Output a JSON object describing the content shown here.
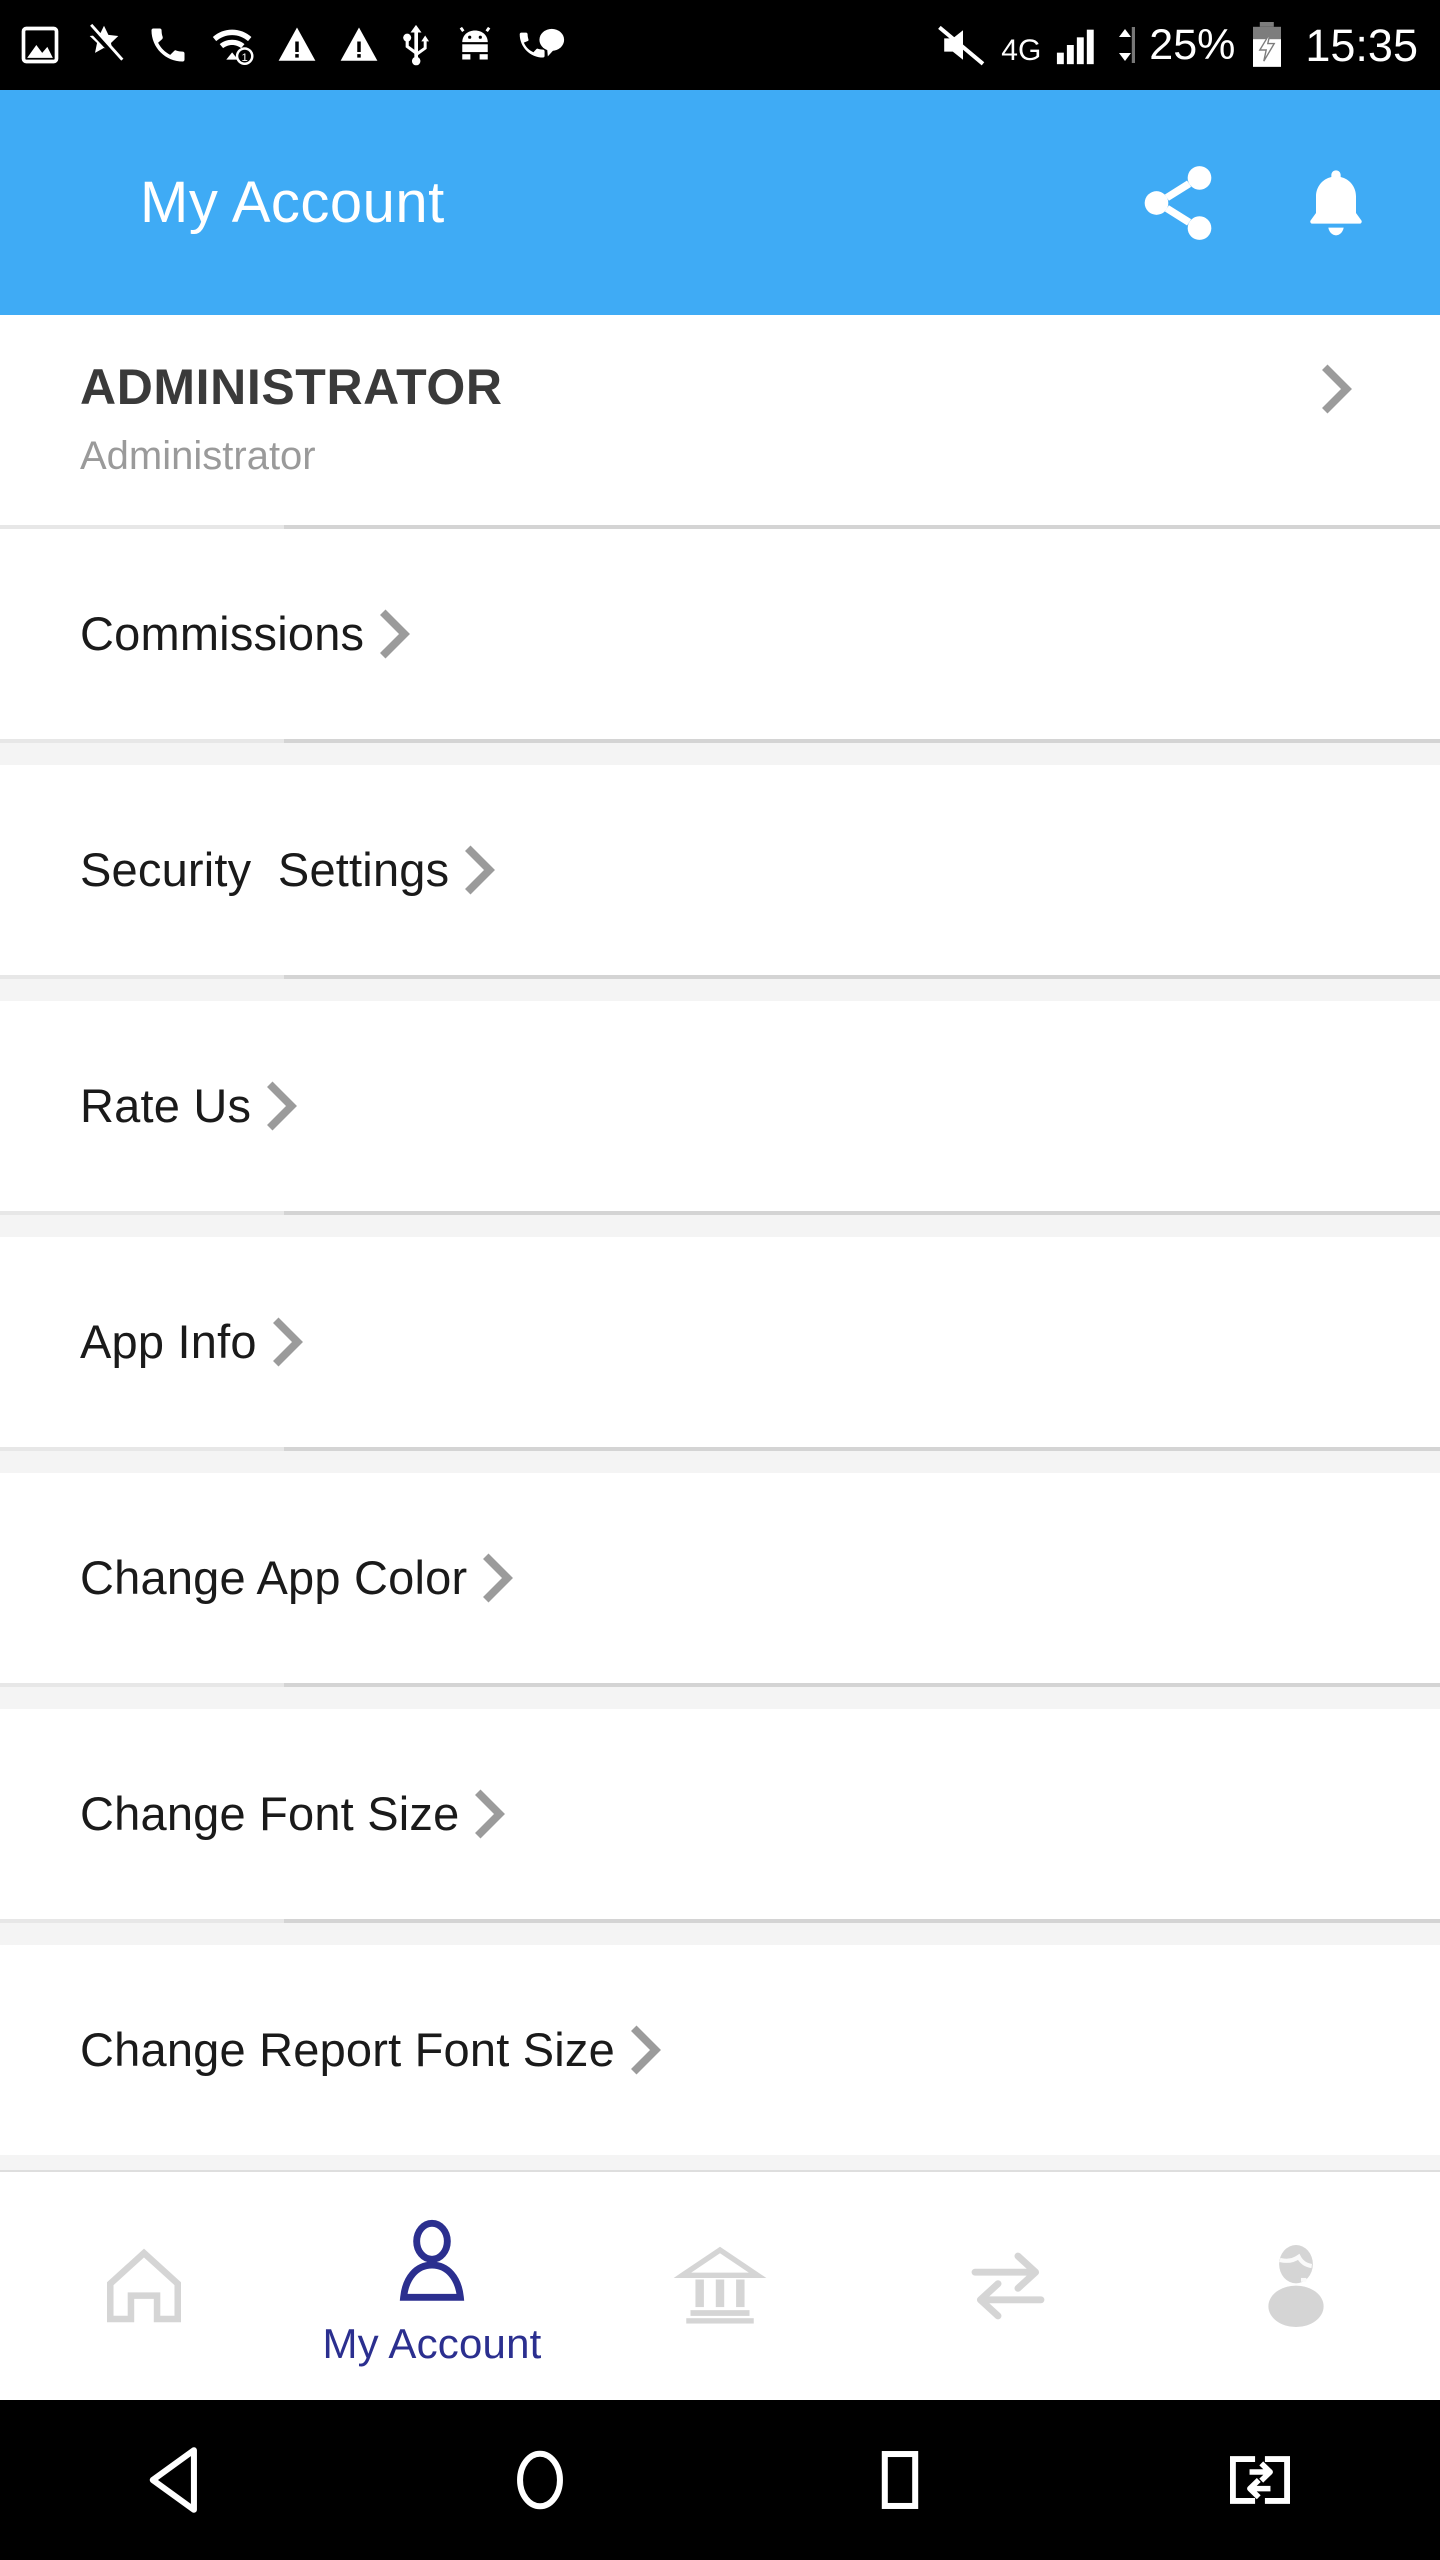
{
  "status_bar": {
    "left_icons": [
      "image-icon",
      "broken-media-icon",
      "call-icon",
      "wifi-icon",
      "warning-icon",
      "warning-icon",
      "usb-icon",
      "android-debug-icon",
      "call-message-icon"
    ],
    "mute_icon": "volume-mute-icon",
    "network_type": "4G",
    "signal_icon": "signal-bars-icon",
    "data_icon": "data-transfer-icon",
    "battery_percent": "25%",
    "battery_icon": "battery-charging-icon",
    "clock": "15:35"
  },
  "app_bar": {
    "title": "My Account",
    "share_icon": "share-icon",
    "notification_icon": "bell-icon"
  },
  "list": {
    "chevron_icon": "chevron-right-icon",
    "items": [
      {
        "title": "ADMINISTRATOR",
        "subtitle": "Administrator",
        "type": "header"
      },
      {
        "title": "Commissions",
        "type": "link"
      },
      {
        "title": "Security  Settings",
        "type": "link"
      },
      {
        "title": "Rate Us",
        "type": "link"
      },
      {
        "title": "App Info",
        "type": "link"
      },
      {
        "title": "Change App Color",
        "type": "link"
      },
      {
        "title": "Change Font Size",
        "type": "link"
      },
      {
        "title": "Change Report Font Size",
        "type": "link"
      }
    ]
  },
  "tab_bar": {
    "active_color": "#2b2f8f",
    "inactive_color": "#d5d5d5",
    "tabs": [
      {
        "label": "",
        "icon": "home-icon",
        "active": false
      },
      {
        "label": "My Account",
        "icon": "person-icon",
        "active": true
      },
      {
        "label": "",
        "icon": "bank-icon",
        "active": false
      },
      {
        "label": "",
        "icon": "transfer-arrows-icon",
        "active": false
      },
      {
        "label": "",
        "icon": "support-agent-icon",
        "active": false
      }
    ]
  },
  "nav_bar": {
    "back_icon": "back-triangle-icon",
    "home_icon": "home-circle-icon",
    "recents_icon": "recents-square-icon",
    "split_screen_icon": "split-screen-swap-icon"
  },
  "colors": {
    "app_bar_blue": "#3FABF5",
    "accent_navy": "#2b2f8f",
    "chevron_gray": "#9b9b9b",
    "divider_light": "#e7e7e7",
    "divider_dark": "#d4d4d4",
    "gap_band": "#f4f4f4"
  }
}
